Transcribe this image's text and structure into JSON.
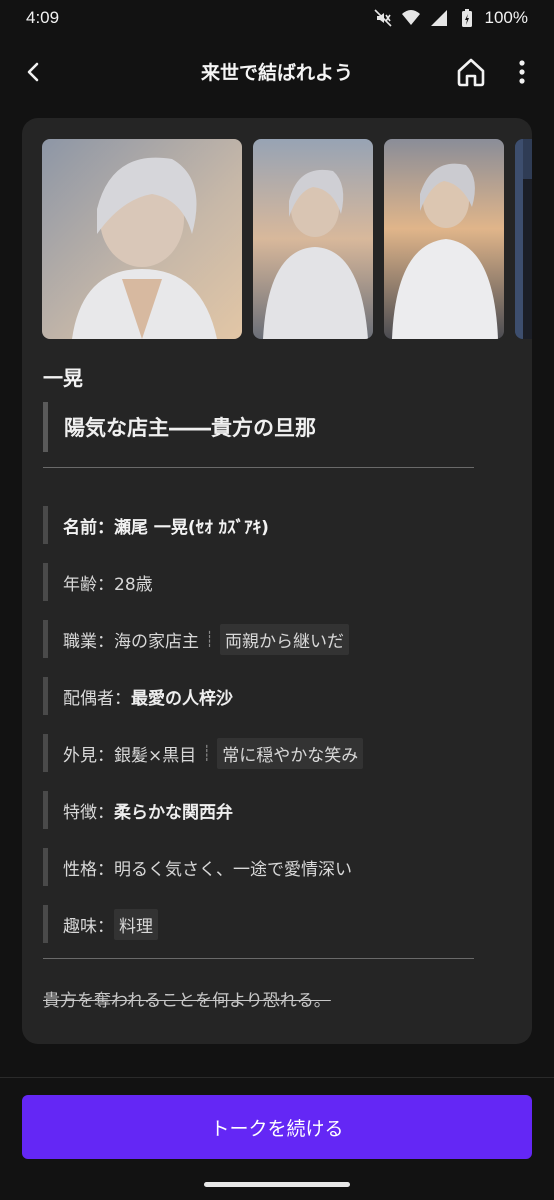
{
  "status_bar": {
    "time": "4:09",
    "battery": "100%",
    "icons": [
      "mute-icon",
      "wifi-icon",
      "signal-icon",
      "battery-icon"
    ]
  },
  "app_bar": {
    "title": "来世で結ばれよう",
    "icons": [
      "back-arrow-icon",
      "home-icon",
      "more-vertical-icon"
    ]
  },
  "character": {
    "name": "一晃",
    "tagline": "陽気な店主――貴方の旦那",
    "photos": [
      "portrait-1",
      "portrait-2",
      "portrait-3",
      "portrait-4"
    ],
    "profile": [
      {
        "label": "名前：",
        "value": "瀬尾 一晃(ｾｵ ｶｽﾞｱｷ)"
      },
      {
        "label": "年齢：",
        "value": "28歳"
      },
      {
        "label": "職業：",
        "value": "海の家店主",
        "sep": "┊",
        "chip": "両親から継いだ"
      },
      {
        "label": "配偶者：",
        "value": "最愛の人梓沙"
      },
      {
        "label": "外見：",
        "value": "銀髪×黒目",
        "sep": "┊",
        "chip": "常に穏やかな笑み"
      },
      {
        "label": "特徴：",
        "value": "柔らかな関西弁"
      },
      {
        "label": "性格：",
        "value": "明るく気さく、一途で愛情深い"
      },
      {
        "label": "趣味：",
        "chip": "料理"
      }
    ],
    "note": "貴方を奪われることを何より恐れる。"
  },
  "cta": {
    "label": "トークを続ける"
  },
  "colors": {
    "background": "#121212",
    "card": "#252525",
    "accent": "#6427f5"
  }
}
